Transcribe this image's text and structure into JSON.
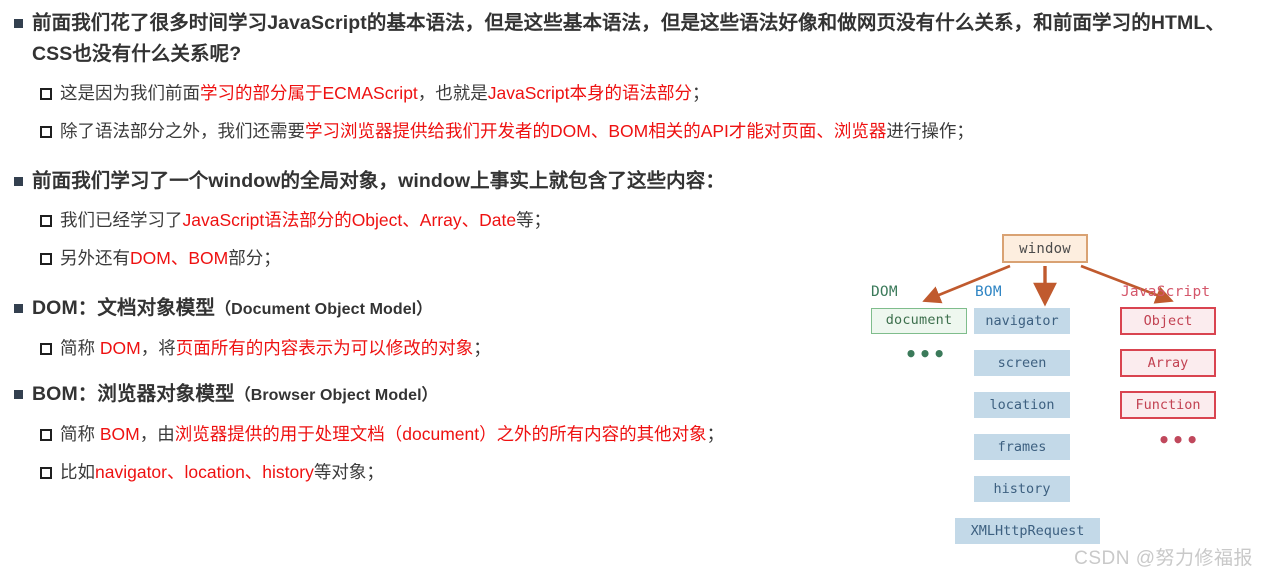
{
  "slide": {
    "blocks": [
      {
        "type": "l1",
        "text": "前面我们花了很多时间学习JavaScript的基本语法，但是这些基本语法，但是这些语法好像和做网页没有什么关系，和前面学习的HTML、CSS也没有什么关系呢?"
      },
      {
        "type": "l2",
        "runs": [
          {
            "t": "这是因为我们前面",
            "c": "plain"
          },
          {
            "t": "学习的部分属于ECMAScript",
            "c": "red"
          },
          {
            "t": "，也就是",
            "c": "plain"
          },
          {
            "t": "JavaScript本身的语法部分",
            "c": "red"
          },
          {
            "t": "；",
            "c": "plain"
          }
        ]
      },
      {
        "type": "l2",
        "runs": [
          {
            "t": "除了语法部分之外，我们还需要",
            "c": "plain"
          },
          {
            "t": "学习浏览器提供给我们开发者的DOM、BOM相关的API才能对页面、浏览器",
            "c": "red"
          },
          {
            "t": "进行操作；",
            "c": "plain"
          }
        ]
      },
      {
        "type": "l1",
        "text": "前面我们学习了一个window的全局对象，window上事实上就包含了这些内容："
      },
      {
        "type": "l2",
        "runs": [
          {
            "t": "我们已经学习了",
            "c": "plain"
          },
          {
            "t": "JavaScript语法部分的Object、Array、Date",
            "c": "red"
          },
          {
            "t": "等；",
            "c": "plain"
          }
        ]
      },
      {
        "type": "l2",
        "runs": [
          {
            "t": "另外还有",
            "c": "plain"
          },
          {
            "t": "DOM、BOM",
            "c": "red"
          },
          {
            "t": "部分；",
            "c": "plain"
          }
        ]
      },
      {
        "type": "l1-mixed",
        "main": "DOM：文档对象模型",
        "paren": "（Document Object Model）"
      },
      {
        "type": "l2",
        "runs": [
          {
            "t": "简称 ",
            "c": "plain"
          },
          {
            "t": "DOM",
            "c": "red"
          },
          {
            "t": "，将",
            "c": "plain"
          },
          {
            "t": "页面所有的内容表示为可以修改的对象",
            "c": "red"
          },
          {
            "t": "；",
            "c": "plain"
          }
        ]
      },
      {
        "type": "l1-mixed",
        "main": "BOM：浏览器对象模型",
        "paren": "（Browser Object Model）"
      },
      {
        "type": "l2",
        "runs": [
          {
            "t": "简称 ",
            "c": "plain"
          },
          {
            "t": "BOM",
            "c": "red"
          },
          {
            "t": "，由",
            "c": "plain"
          },
          {
            "t": "浏览器提供的用于处理文档（document）之外的所有内容的其他对象",
            "c": "red"
          },
          {
            "t": "；",
            "c": "plain"
          }
        ]
      },
      {
        "type": "l2",
        "runs": [
          {
            "t": "比如",
            "c": "plain"
          },
          {
            "t": "navigator、location、history",
            "c": "red"
          },
          {
            "t": "等对象；",
            "c": "plain"
          }
        ]
      }
    ]
  },
  "diagram": {
    "root": {
      "label": "window",
      "fill": "#fdeedf",
      "border": "#d9a273"
    },
    "columns": [
      {
        "name": "dom",
        "label": "DOM",
        "label_color": "#3b7a5a",
        "items": [
          "document"
        ],
        "ellipsis": "•••"
      },
      {
        "name": "bom",
        "label": "BOM",
        "label_color": "#2f85c4",
        "items": [
          "navigator",
          "screen",
          "location",
          "frames",
          "history",
          "XMLHttpRequest"
        ],
        "ellipsis": ""
      },
      {
        "name": "javascript",
        "label": "JavaScript",
        "label_color": "#d4566a",
        "items": [
          "Object",
          "Array",
          "Function"
        ],
        "ellipsis": "•••"
      }
    ],
    "arrow_color": "#c05a2e"
  },
  "watermark": {
    "text": "CSDN @努力修福报"
  },
  "colors": {
    "highlight_red": "#ee1111",
    "body_text": "#333333",
    "bullet_square": "#33404f",
    "dom_green": "#3b7a5a",
    "bom_blue": "#2f85c4",
    "js_red": "#d4566a",
    "arrow_brown": "#c05a2e"
  }
}
